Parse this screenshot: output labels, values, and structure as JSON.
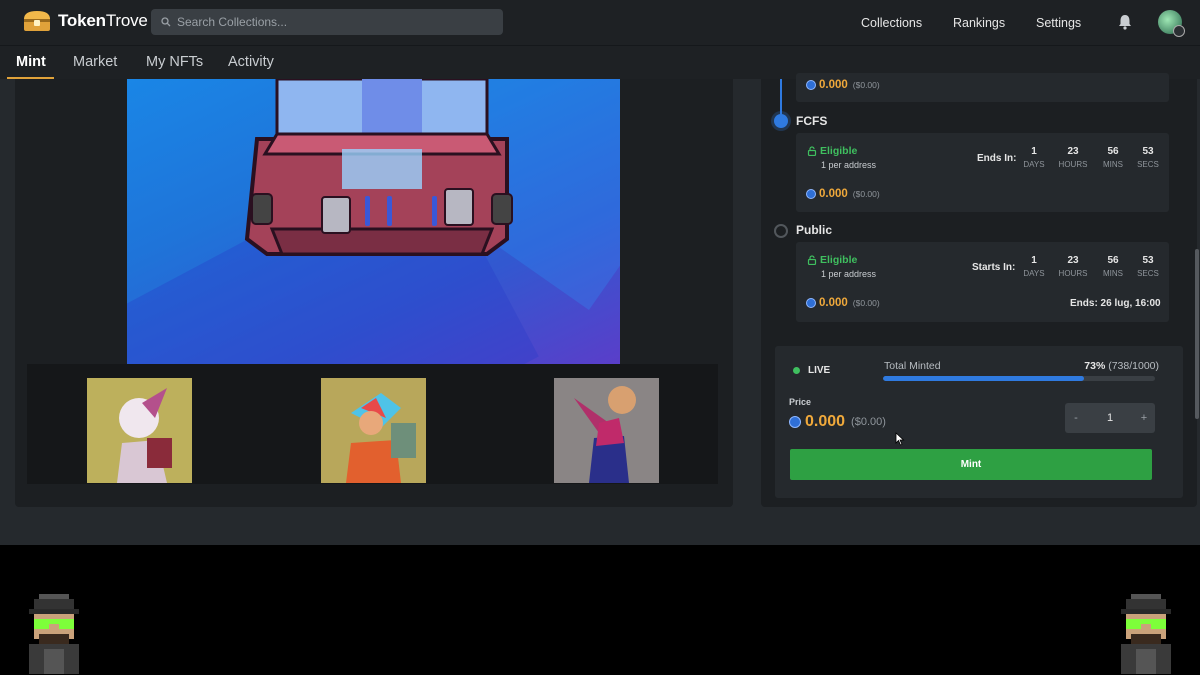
{
  "header": {
    "brand_bold": "Token",
    "brand_regular": "Trove",
    "search_placeholder": "Search Collections...",
    "nav": [
      {
        "label": "Collections"
      },
      {
        "label": "Rankings"
      },
      {
        "label": "Settings"
      }
    ]
  },
  "tabs": [
    {
      "label": "Mint",
      "active": true
    },
    {
      "label": "Market"
    },
    {
      "label": "My NFTs"
    },
    {
      "label": "Activity"
    }
  ],
  "stages": {
    "previous": {
      "price": "0.000",
      "price_usd": "($0.00)"
    },
    "fcfs": {
      "title": "FCFS",
      "eligible": "Eligible",
      "limit": "1 per address",
      "countdown_label": "Ends In:",
      "countdown": [
        {
          "value": "1",
          "unit": "DAYS"
        },
        {
          "value": "23",
          "unit": "HOURS"
        },
        {
          "value": "56",
          "unit": "MINS"
        },
        {
          "value": "53",
          "unit": "SECS"
        }
      ],
      "price": "0.000",
      "price_usd": "($0.00)"
    },
    "public": {
      "title": "Public",
      "eligible": "Eligible",
      "limit": "1 per address",
      "countdown_label": "Starts In:",
      "countdown": [
        {
          "value": "1",
          "unit": "DAYS"
        },
        {
          "value": "23",
          "unit": "HOURS"
        },
        {
          "value": "56",
          "unit": "MINS"
        },
        {
          "value": "53",
          "unit": "SECS"
        }
      ],
      "price": "0.000",
      "price_usd": "($0.00)",
      "ends": "Ends: 26 lug, 16:00"
    }
  },
  "mint": {
    "status": "LIVE",
    "total_minted_label": "Total Minted",
    "percent": "73%",
    "count": "(738/1000)",
    "progress_fraction": 0.738,
    "price_label": "Price",
    "price": "0.000",
    "price_usd": "($0.00)",
    "quantity": "1",
    "minus": "-",
    "plus": "+",
    "button_label": "Mint"
  },
  "colors": {
    "accent_blue": "#2f7ae0",
    "price_orange": "#f0a93b",
    "eligible_green": "#3fbf5f",
    "mint_green": "#2ea043",
    "tab_underline": "#e0a23a"
  },
  "icons": {
    "search": "search-icon",
    "bell": "bell-icon",
    "lock": "unlock-icon",
    "coin": "coin-icon"
  }
}
